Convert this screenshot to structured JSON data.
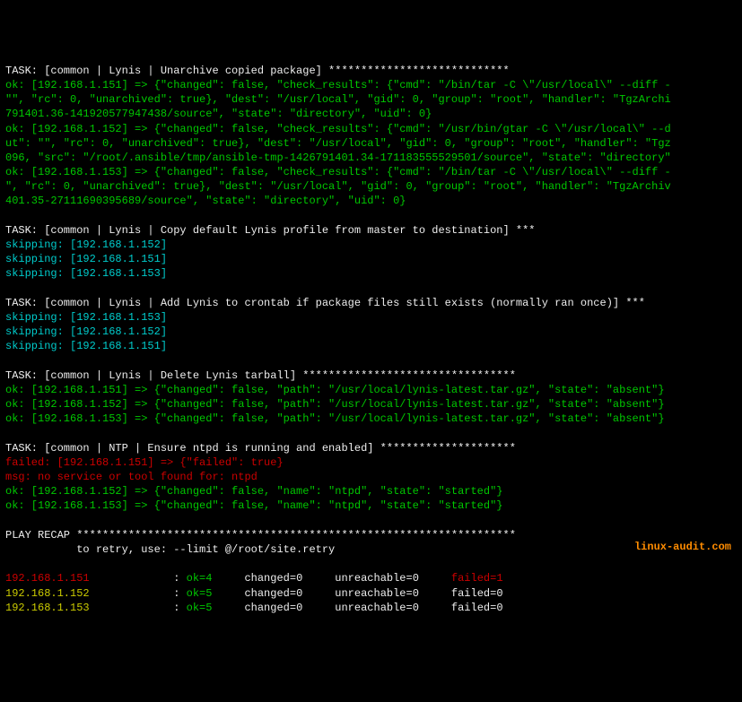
{
  "tasks": {
    "unarchive": {
      "header": "TASK: [common | Lynis | Unarchive copied package] ****************************",
      "lines": [
        {
          "class": "green",
          "text": "ok: [192.168.1.151] => {\"changed\": false, \"check_results\": {\"cmd\": \"/bin/tar -C \\\"/usr/local\\\" --diff -"
        },
        {
          "class": "green",
          "text": "\"\", \"rc\": 0, \"unarchived\": true}, \"dest\": \"/usr/local\", \"gid\": 0, \"group\": \"root\", \"handler\": \"TgzArchi"
        },
        {
          "class": "green",
          "text": "791401.36-141920577947438/source\", \"state\": \"directory\", \"uid\": 0}"
        },
        {
          "class": "green",
          "text": "ok: [192.168.1.152] => {\"changed\": false, \"check_results\": {\"cmd\": \"/usr/bin/gtar -C \\\"/usr/local\\\" --d"
        },
        {
          "class": "green",
          "text": "ut\": \"\", \"rc\": 0, \"unarchived\": true}, \"dest\": \"/usr/local\", \"gid\": 0, \"group\": \"root\", \"handler\": \"Tgz"
        },
        {
          "class": "green",
          "text": "096, \"src\": \"/root/.ansible/tmp/ansible-tmp-1426791401.34-171183555529501/source\", \"state\": \"directory\""
        },
        {
          "class": "green",
          "text": "ok: [192.168.1.153] => {\"changed\": false, \"check_results\": {\"cmd\": \"/bin/tar -C \\\"/usr/local\\\" --diff -"
        },
        {
          "class": "green",
          "text": "\", \"rc\": 0, \"unarchived\": true}, \"dest\": \"/usr/local\", \"gid\": 0, \"group\": \"root\", \"handler\": \"TgzArchiv"
        },
        {
          "class": "green",
          "text": "401.35-27111690395689/source\", \"state\": \"directory\", \"uid\": 0}"
        }
      ]
    },
    "copyProfile": {
      "header": "TASK: [common | Lynis | Copy default Lynis profile from master to destination] ***",
      "lines": [
        {
          "class": "cyan",
          "text": "skipping: [192.168.1.152]"
        },
        {
          "class": "cyan",
          "text": "skipping: [192.168.1.151]"
        },
        {
          "class": "cyan",
          "text": "skipping: [192.168.1.153]"
        }
      ]
    },
    "crontab": {
      "header": "TASK: [common | Lynis | Add Lynis to crontab if package files still exists (normally ran once)] ***",
      "lines": [
        {
          "class": "cyan",
          "text": "skipping: [192.168.1.153]"
        },
        {
          "class": "cyan",
          "text": "skipping: [192.168.1.152]"
        },
        {
          "class": "cyan",
          "text": "skipping: [192.168.1.151]"
        }
      ]
    },
    "delete": {
      "header": "TASK: [common | Lynis | Delete Lynis tarball] *********************************",
      "lines": [
        {
          "class": "green",
          "text": "ok: [192.168.1.151] => {\"changed\": false, \"path\": \"/usr/local/lynis-latest.tar.gz\", \"state\": \"absent\"}"
        },
        {
          "class": "green",
          "text": "ok: [192.168.1.152] => {\"changed\": false, \"path\": \"/usr/local/lynis-latest.tar.gz\", \"state\": \"absent\"}"
        },
        {
          "class": "green",
          "text": "ok: [192.168.1.153] => {\"changed\": false, \"path\": \"/usr/local/lynis-latest.tar.gz\", \"state\": \"absent\"}"
        }
      ]
    },
    "ntpd": {
      "header": "TASK: [common | NTP | Ensure ntpd is running and enabled] *********************",
      "lines": [
        {
          "class": "red",
          "text": "failed: [192.168.1.151] => {\"failed\": true}"
        },
        {
          "class": "red",
          "text": "msg: no service or tool found for: ntpd"
        },
        {
          "class": "green",
          "text": "ok: [192.168.1.152] => {\"changed\": false, \"name\": \"ntpd\", \"state\": \"started\"}"
        },
        {
          "class": "green",
          "text": "ok: [192.168.1.153] => {\"changed\": false, \"name\": \"ntpd\", \"state\": \"started\"}"
        }
      ]
    }
  },
  "recap": {
    "header": "PLAY RECAP ********************************************************************",
    "retry": "           to retry, use: --limit @/root/site.retry",
    "rows": [
      {
        "host": "192.168.1.151",
        "hostClass": "red",
        "ok": "ok=4",
        "changed": "changed=0",
        "unreachable": "unreachable=0",
        "failed": "failed=1",
        "failedClass": "red"
      },
      {
        "host": "192.168.1.152",
        "hostClass": "yellow",
        "ok": "ok=5",
        "changed": "changed=0",
        "unreachable": "unreachable=0",
        "failed": "failed=0",
        "failedClass": "white"
      },
      {
        "host": "192.168.1.153",
        "hostClass": "yellow",
        "ok": "ok=5",
        "changed": "changed=0",
        "unreachable": "unreachable=0",
        "failed": "failed=0",
        "failedClass": "white"
      }
    ]
  },
  "watermark": "linux-audit.com"
}
